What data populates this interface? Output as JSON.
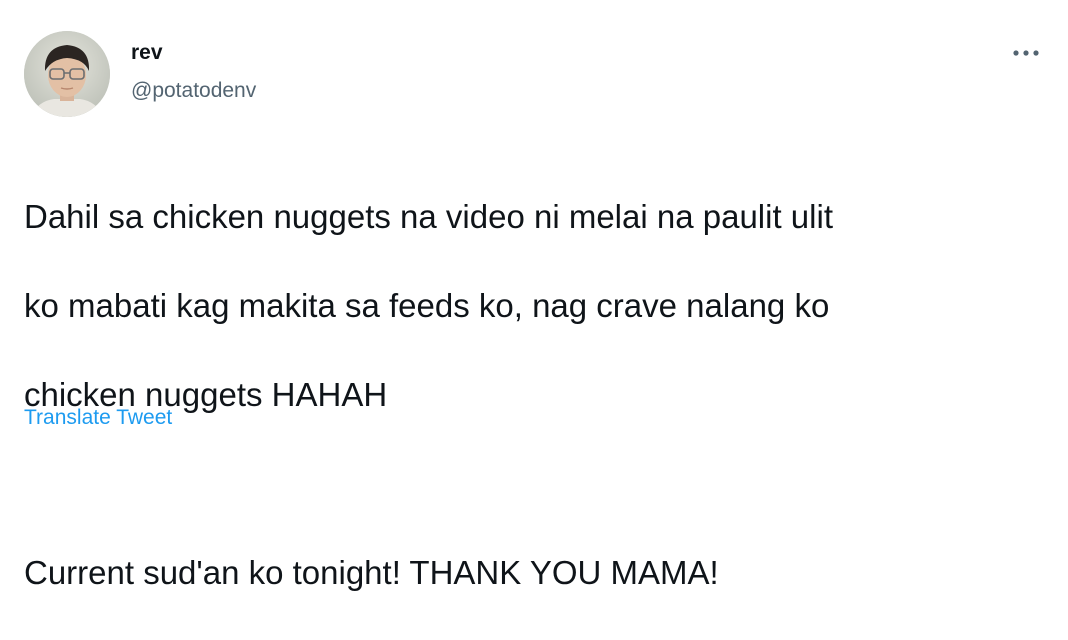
{
  "author": {
    "display_name": "rev",
    "handle": "@potatodenv",
    "avatar_icon": "user-photo-avatar"
  },
  "menu": {
    "icon": "more-horizontal-icon"
  },
  "tweet": {
    "lines": [
      "Dahil sa chicken nuggets na video ni melai na paulit ulit",
      "ko mabati kag makita sa feeds ko, nag crave nalang ko",
      "chicken nuggets HAHAH",
      "",
      "Current sud'an ko tonight! THANK YOU MAMA!"
    ]
  },
  "translate": {
    "label": "Translate Tweet"
  },
  "colors": {
    "text_primary": "#0f1419",
    "text_secondary": "#536471",
    "link": "#1d9bf0",
    "background": "#ffffff"
  }
}
